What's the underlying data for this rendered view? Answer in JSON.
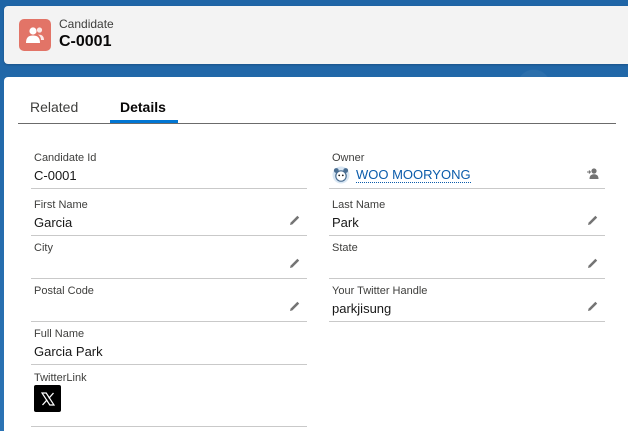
{
  "header": {
    "object_type": "Candidate",
    "record_name": "C-0001"
  },
  "tabs": [
    {
      "label": "Related",
      "active": false
    },
    {
      "label": "Details",
      "active": true
    }
  ],
  "fields": {
    "candidate_id": {
      "label": "Candidate Id",
      "value": "C-0001"
    },
    "owner": {
      "label": "Owner",
      "value": "WOO MOORYONG"
    },
    "first_name": {
      "label": "First Name",
      "value": "Garcia"
    },
    "last_name": {
      "label": "Last Name",
      "value": "Park"
    },
    "city": {
      "label": "City",
      "value": ""
    },
    "state": {
      "label": "State",
      "value": ""
    },
    "postal_code": {
      "label": "Postal Code",
      "value": ""
    },
    "twitter_handle": {
      "label": "Your Twitter Handle",
      "value": "parkjisung"
    },
    "full_name": {
      "label": "Full Name",
      "value": "Garcia Park"
    },
    "twitter_link": {
      "label": "TwitterLink"
    }
  },
  "icons": {
    "object": "candidate-icon",
    "edit": "pencil-icon",
    "change_owner": "change-owner-icon",
    "twitter": "x-logo-icon"
  },
  "colors": {
    "accent": "#0176d3",
    "object_icon_bg": "#e27467",
    "link": "#0b5cab"
  }
}
